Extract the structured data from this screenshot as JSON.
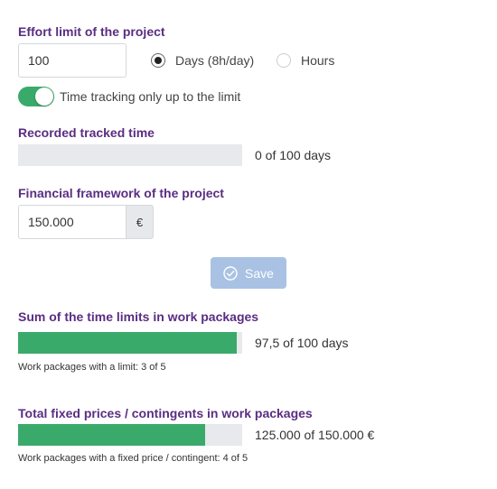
{
  "effort": {
    "label": "Effort limit of the project",
    "value": "100",
    "unit_options": [
      {
        "label": "Days (8h/day)",
        "selected": true
      },
      {
        "label": "Hours",
        "selected": false
      }
    ]
  },
  "time_tracking": {
    "label": "Time tracking only up to the limit",
    "enabled": true
  },
  "recorded": {
    "label": "Recorded tracked time",
    "progress_fraction": 0,
    "value_text": "0 of 100 days"
  },
  "financial": {
    "label": "Financial framework of the project",
    "value": "150.000",
    "currency": "€"
  },
  "save": {
    "label": "Save",
    "icon": "check-circle-icon"
  },
  "time_limits": {
    "label": "Sum of the time limits in work packages",
    "progress_fraction": 0.975,
    "value_text": "97,5 of 100 days",
    "note": "Work packages with a limit: 3 of 5"
  },
  "fixed_prices": {
    "label": "Total fixed prices / contingents in work packages",
    "progress_fraction": 0.8333,
    "value_text": "125.000 of 150.000 €",
    "note": "Work packages with a fixed price / contingent: 4 of 5"
  },
  "colors": {
    "heading": "#5a2d82",
    "progress": "#3aaa6b",
    "track": "#e7e9ec",
    "save_button": "#a9c2e4"
  }
}
